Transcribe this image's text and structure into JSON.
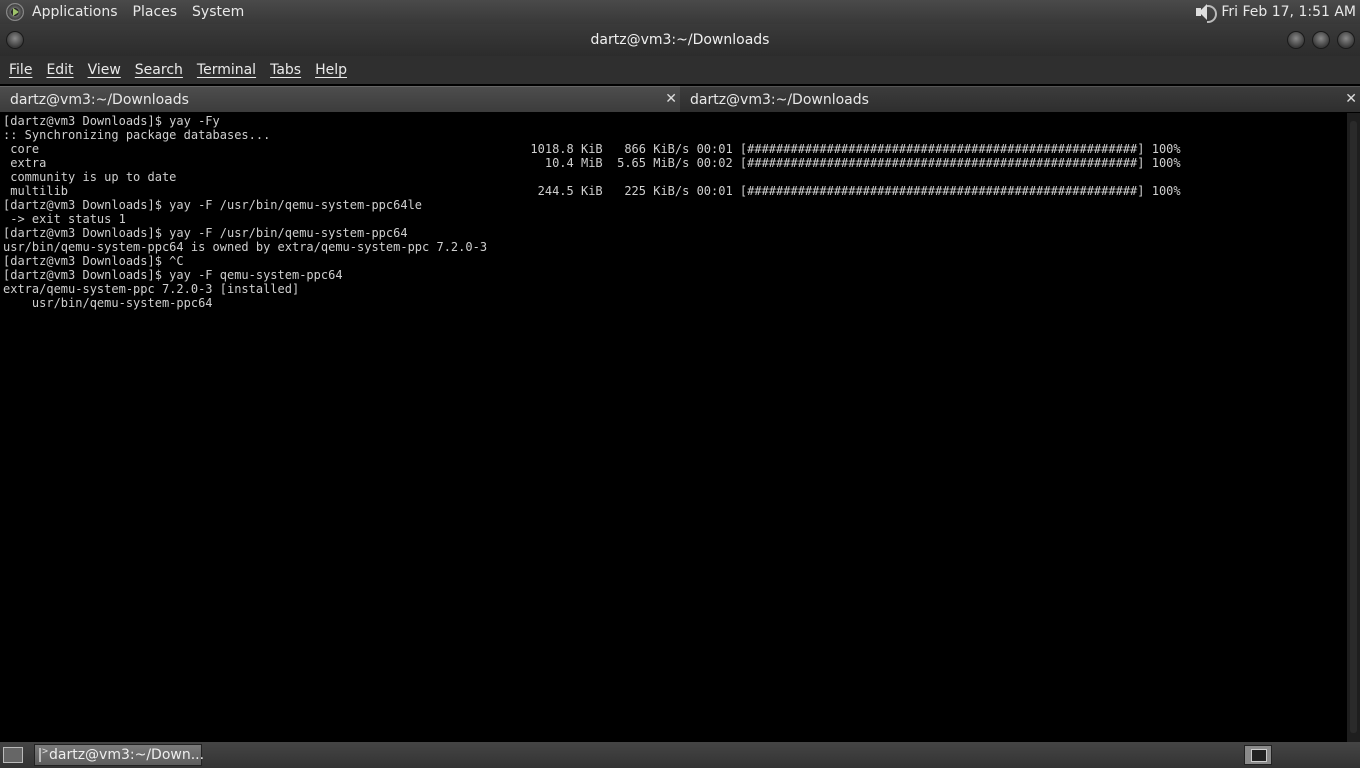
{
  "top_panel": {
    "menus": [
      "Applications",
      "Places",
      "System"
    ],
    "clock": "Fri Feb 17,  1:51 AM"
  },
  "window": {
    "title": "dartz@vm3:~/Downloads"
  },
  "menubar": [
    "File",
    "Edit",
    "View",
    "Search",
    "Terminal",
    "Tabs",
    "Help"
  ],
  "tabs": [
    {
      "label": "dartz@vm3:~/Downloads",
      "close": "✕"
    },
    {
      "label": "dartz@vm3:~/Downloads",
      "close": "✕"
    }
  ],
  "terminal": {
    "lines": [
      "[dartz@vm3 Downloads]$ yay -Fy",
      ":: Synchronizing package databases...",
      " core                                                                    1018.8 KiB   866 KiB/s 00:01 [######################################################] 100%",
      " extra                                                                     10.4 MiB  5.65 MiB/s 00:02 [######################################################] 100%",
      " community is up to date",
      " multilib                                                                 244.5 KiB   225 KiB/s 00:01 [######################################################] 100%",
      "[dartz@vm3 Downloads]$ yay -F /usr/bin/qemu-system-ppc64le",
      " -> exit status 1",
      "[dartz@vm3 Downloads]$ yay -F /usr/bin/qemu-system-ppc64",
      "usr/bin/qemu-system-ppc64 is owned by extra/qemu-system-ppc 7.2.0-3",
      "[dartz@vm3 Downloads]$ ^C",
      "[dartz@vm3 Downloads]$ yay -F qemu-system-ppc64",
      "extra/qemu-system-ppc 7.2.0-3 [installed]",
      "    usr/bin/qemu-system-ppc64"
    ]
  },
  "taskbar": {
    "task_label": "dartz@vm3:~/Down..."
  }
}
